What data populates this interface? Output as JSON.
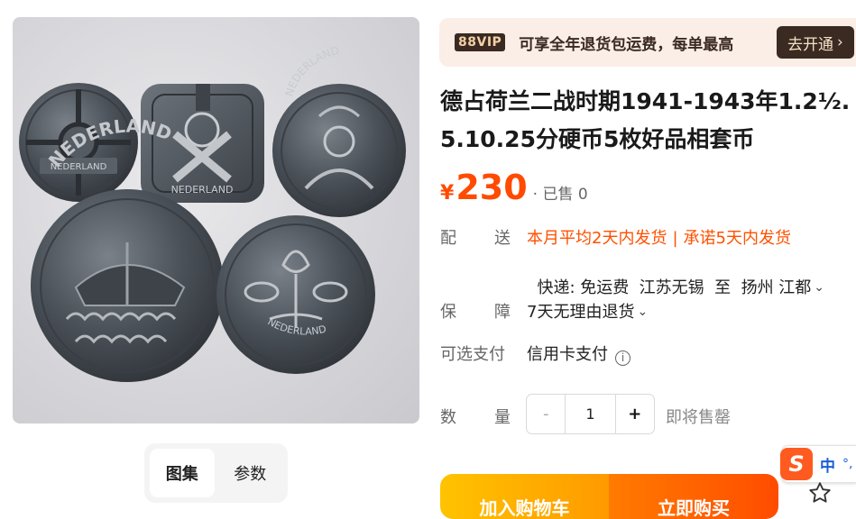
{
  "gallery": {
    "tabs": [
      "图集",
      "参数"
    ],
    "active_tab": 0,
    "coin_inscriptions": [
      "NEDERLAND",
      "NEDERLAND",
      "NEDERLAND",
      "NEDERLAND",
      "NEDERLAND"
    ]
  },
  "vip": {
    "badge": "88VIP",
    "text": "可享全年退货包运费，每单最高",
    "open_label": "去开通",
    "open_chevron": "›"
  },
  "product": {
    "title_line1": "德占荷兰二战时期1941-1943年1.2½.",
    "title_line2": "5.10.25分硬币5枚好品相套币"
  },
  "price": {
    "currency": "¥",
    "value": "230",
    "sold": "· 已售 0"
  },
  "shipping": {
    "label_a": "配",
    "label_b": "送",
    "promise_1": "本月平均2天内发货",
    "separator": "|",
    "promise_2": "承诺5天内发货",
    "detail": "快递: 免运费  江苏无锡  至  扬州 江都"
  },
  "guarantee": {
    "label_a": "保",
    "label_b": "障",
    "value": "7天无理由退货"
  },
  "payment": {
    "label": "可选支付",
    "value": "信用卡支付",
    "info_icon": "i"
  },
  "quantity": {
    "label_a": "数",
    "label_b": "量",
    "minus": "-",
    "value": "1",
    "plus": "+",
    "status": "即将售罄"
  },
  "actions": {
    "add_to_cart": "加入购物车",
    "buy_now": "立即购买"
  },
  "ime": {
    "logo": "S",
    "lang": "中",
    "punct": "°,"
  },
  "colors": {
    "price": "#ff4a00",
    "promise": "#ff5000",
    "vip_bg": "#fbeee6",
    "vip_dark": "#3a2a22",
    "cart": "#ffb000",
    "buy": "#ff5a00"
  },
  "icons": [
    "chevron-down-icon",
    "info-icon",
    "star-icon",
    "ime-logo-icon"
  ]
}
